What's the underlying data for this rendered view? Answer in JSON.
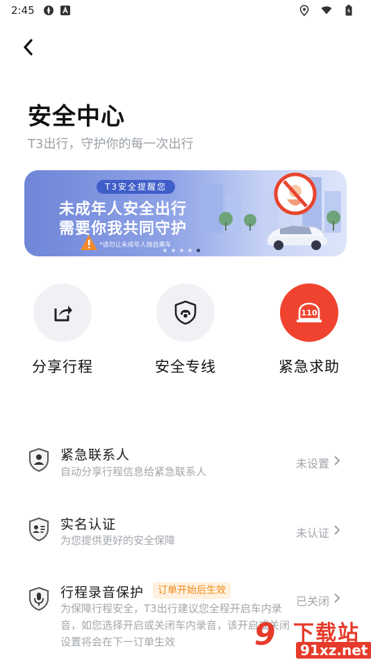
{
  "status_bar": {
    "time": "2:45"
  },
  "header": {
    "title": "安全中心",
    "subtitle": "T3出行，守护你的每一次出行"
  },
  "banner": {
    "tag": "T3安全提醒您",
    "line1": "未成年人安全出行",
    "line2": "需要你我共同守护",
    "note": "*请勿让未成年人独自乘车",
    "page_count": 5,
    "active_page": 5
  },
  "quick_actions": [
    {
      "label": "分享行程",
      "icon": "share-icon"
    },
    {
      "label": "安全专线",
      "icon": "shield-phone-icon"
    },
    {
      "label": "紧急求助",
      "icon": "alarm-110-icon"
    }
  ],
  "settings": [
    {
      "title": "紧急联系人",
      "desc": "自动分享行程信息给紧急联系人",
      "status": "未设置",
      "icon": "contact-shield-icon"
    },
    {
      "title": "实名认证",
      "desc": "为您提供更好的安全保障",
      "status": "未认证",
      "icon": "id-card-shield-icon"
    },
    {
      "title": "行程录音保护",
      "badge": "订单开始后生效",
      "desc": "为保障行程安全，T3出行建议您全程开启车内录音，如您选择开启或关闭车内录音，该开启或关闭设置将会在下一订单生效",
      "status": "已关闭",
      "icon": "microphone-shield-icon"
    }
  ],
  "watermark": {
    "logo": "9",
    "top": "下载站",
    "bottom": "91xz.net"
  },
  "colors": {
    "emergency": "#f0432f",
    "badge_text": "#f08a1b",
    "badge_bg": "#fff1de"
  }
}
